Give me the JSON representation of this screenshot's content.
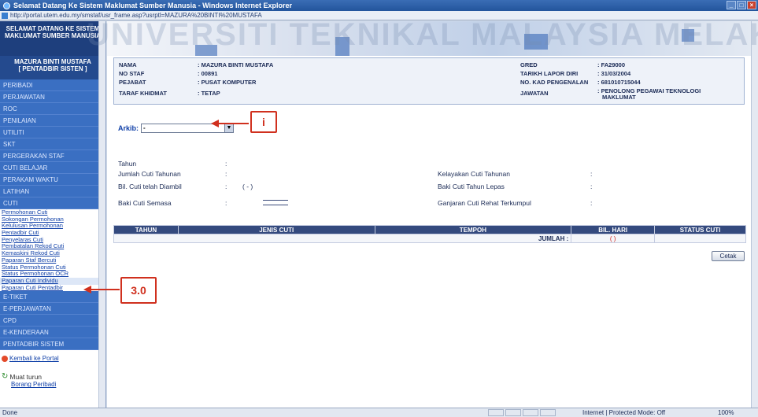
{
  "window": {
    "title": "Selamat Datang Ke Sistem Maklumat Sumber Manusia - Windows Internet Explorer",
    "url": "http://portal.utem.edu.my/smstaf/usr_frame.asp?usrptl=MAZURA%20BINTI%20MUSTAFA",
    "controls": [
      "_",
      "□",
      "×"
    ],
    "watermark": "UNIVERSITI TEKNIKAL MALAYSIA MELAKA"
  },
  "sidebar": {
    "header": "SELAMAT DATANG KE SISTEM MAKLUMAT SUMBER MANUSIA",
    "user_line1": "MAZURA BINTI MUSTAFA",
    "user_line2": "[ PENTADBIR SISTEN ]",
    "menu": [
      "PERIBADI",
      "PERJAWATAN",
      "ROC",
      "PENILAIAN",
      "UTILITI",
      "SKT",
      "PERGERAKAN STAF",
      "CUTI BELAJAR",
      "PERAKAM WAKTU",
      "LATIHAN",
      "CUTI"
    ],
    "submenu": [
      "Permohonan Cuti",
      "Sokongan Permohonan",
      "Kelulusan Permohonan",
      "Pentadbir Cuti",
      "Penyelaras Cuti",
      "Pembatalan Rekod Cuti",
      "Kemaskini Rekod Cuti",
      "Paparan Staf Bercuti",
      "Status Permohonan Cuti",
      "Status Permohonan OCR",
      "Paparan Cuti Individu",
      "Paparan Cuti Pentadbir"
    ],
    "menu2": [
      "E-TIKET",
      "E-PERJAWATAN",
      "CPD",
      "E-KENDERAAN",
      "PENTADBIR SISTEM"
    ],
    "portal_link": "Kembali ke Portal",
    "download_label": "Muat turun",
    "download_sub": "Borang Peribadi"
  },
  "info": {
    "nama_label": "NAMA",
    "nama_value": ": MAZURA BINTI MUSTAFA",
    "nostaf_label": "NO STAF",
    "nostaf_value": ": 00891",
    "pejabat_label": "PEJABAT",
    "pejabat_value": ": PUSAT KOMPUTER",
    "taraf_label": "TARAF KHIDMAT",
    "taraf_value": ": TETAP",
    "gred_label": "GRED",
    "gred_value": ": FA29000",
    "tarikh_label": "TARIKH LAPOR DIRI",
    "tarikh_value": ": 31/03/2004",
    "kp_label": "NO. KAD PENGENALAN",
    "kp_value": ": 681010715044",
    "jawatan_label": "JAWATAN",
    "jawatan_value": ": PENOLONG PEGAWAI TEKNOLOGI",
    "jawatan_value2": "MAKLUMAT"
  },
  "arkib": {
    "label": "Arkib:",
    "value": "-",
    "dd": "▼"
  },
  "summary": {
    "tahun": "Tahun",
    "jumlah": "Jumlah Cuti Tahunan",
    "bil": "Bil. Cuti telah Diambil",
    "baki": "Baki Cuti Semasa",
    "colon": ":",
    "bil_value": "( - )",
    "kelayakan": "Kelayakan Cuti Tahunan",
    "baki_lepas": "Baki Cuti Tahun Lepas",
    "ganjaran": "Ganjaran Cuti Rehat Terkumpul"
  },
  "table": {
    "headers": [
      "TAHUN",
      "JENIS CUTI",
      "TEMPOH",
      "BIL. HARI",
      "STATUS CUTI"
    ],
    "total_label": "JUMLAH :",
    "total_value": "( )"
  },
  "cetak_label": "Cetak",
  "callouts": {
    "i": "i",
    "three": "3.0"
  },
  "status": {
    "done": "Done",
    "zone": "Internet | Protected Mode: Off",
    "zoom": "100%"
  }
}
